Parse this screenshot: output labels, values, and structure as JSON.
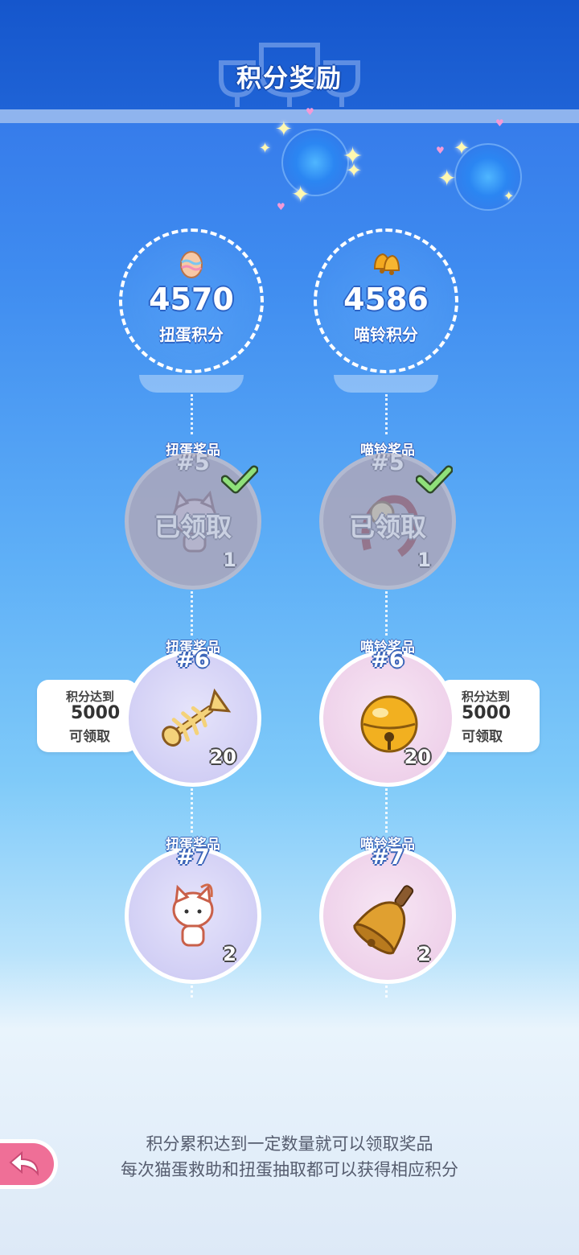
{
  "header": {
    "title": "积分奖励"
  },
  "scores": {
    "egg": {
      "icon": "egg-icon",
      "value": "4570",
      "label": "扭蛋积分"
    },
    "bell": {
      "icon": "bell-icon",
      "value": "4586",
      "label": "喵铃积分"
    }
  },
  "rewards": {
    "egg": [
      {
        "label": "扭蛋奖品",
        "number": "#5",
        "count": "1",
        "state": "已领取",
        "item": "cat-charm-icon"
      },
      {
        "label": "扭蛋奖品",
        "number": "#6",
        "count": "20",
        "item": "fishbone-icon"
      },
      {
        "label": "扭蛋奖品",
        "number": "#7",
        "count": "2",
        "item": "white-cat-charm-icon"
      }
    ],
    "bell": [
      {
        "label": "喵铃奖品",
        "number": "#5",
        "count": "1",
        "state": "已领取",
        "item": "bell-strap-icon"
      },
      {
        "label": "喵铃奖品",
        "number": "#6",
        "count": "20",
        "item": "gold-bell-icon"
      },
      {
        "label": "喵铃奖品",
        "number": "#7",
        "count": "2",
        "item": "hand-bell-icon"
      }
    ]
  },
  "requirements": {
    "egg": {
      "line1": "积分达到",
      "line2": "5000",
      "line3": "可领取"
    },
    "bell": {
      "line1": "积分达到",
      "line2": "5000",
      "line3": "可领取"
    }
  },
  "footer": {
    "line1": "积分累积达到一定数量就可以领取奖品",
    "line2": "每次猫蛋救助和扭蛋抽取都可以获得相应积分"
  },
  "colors": {
    "header": "#1556cc",
    "accent_pink": "#ef6f97",
    "egg_circle": "#c9c6f2",
    "bell_circle": "#ebc9e6"
  }
}
